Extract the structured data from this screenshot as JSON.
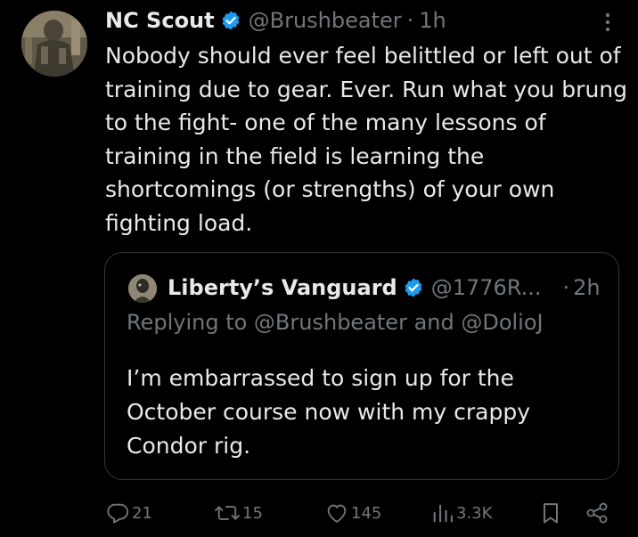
{
  "tweet": {
    "display_name": "NC Scout",
    "handle": "@Brushbeater",
    "separator": "·",
    "time": "1h",
    "text": "Nobody should ever feel belittled or left out of\ntraining due to gear. Ever. Run what you brung\nto the fight- one of the many lessons of\ntraining in the field is learning the\nshortcomings (or strengths) of your own\nfighting load.",
    "more_icon": "more-icon",
    "verified_icon": "verified-badge-icon"
  },
  "quote": {
    "display_name": "Liberty’s Vanguard",
    "handle": "@1776R...",
    "separator": "·",
    "time": "2h",
    "replying_to": "Replying to @Brushbeater and @DolioJ",
    "text": "I’m embarrassed to sign up for the\nOctober course now with my crappy\nCondor rig."
  },
  "actions": {
    "replies": "21",
    "reposts": "15",
    "likes": "145",
    "views": "3.3K",
    "icons": [
      "reply-icon",
      "repost-icon",
      "like-icon",
      "views-icon",
      "bookmark-icon",
      "share-icon"
    ]
  },
  "colors": {
    "background": "#000000",
    "text": "#e7e9ea",
    "secondary": "#71767b",
    "verified": "#1d9bf0",
    "border": "#2f3336"
  }
}
